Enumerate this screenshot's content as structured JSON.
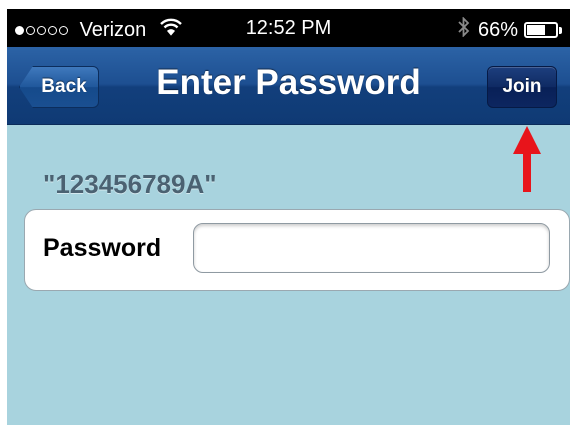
{
  "status_bar": {
    "carrier": "Verizon",
    "time": "12:52 PM",
    "battery_percent": "66%",
    "battery_level": 0.66,
    "signal_bars": 1,
    "signal_total": 5
  },
  "nav": {
    "title": "Enter Password",
    "back_label": "Back",
    "join_label": "Join"
  },
  "network": {
    "name": "\"123456789A\""
  },
  "form": {
    "password_label": "Password",
    "password_value": ""
  },
  "colors": {
    "nav_blue": "#1d4f91",
    "background": "#a8d3de",
    "arrow": "#e8141b"
  }
}
